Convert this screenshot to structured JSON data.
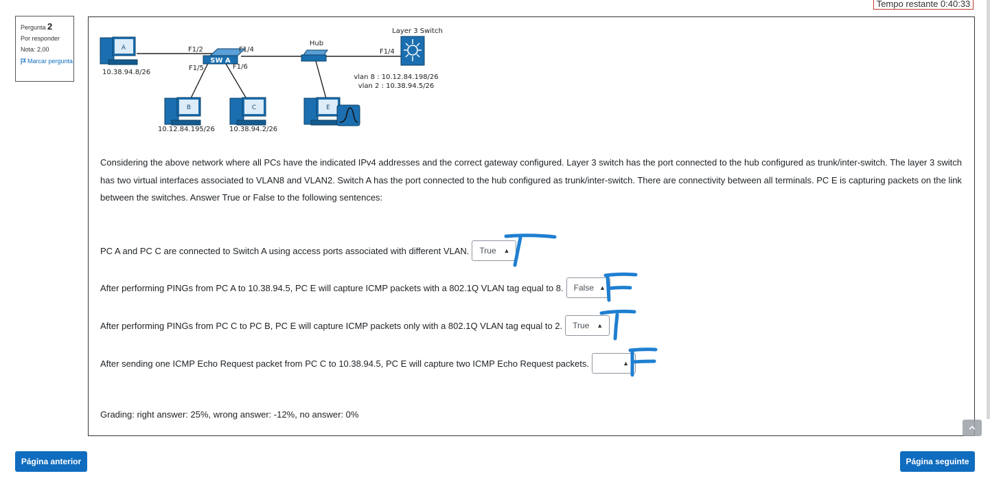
{
  "timer": {
    "label": "Tempo restante 0:40:33"
  },
  "question_info": {
    "label": "Pergunta",
    "number": "2",
    "status": "Por responder",
    "grade": "Nota: 2,00",
    "flag_label": "Marcar pergunta"
  },
  "diagram": {
    "pc_a": {
      "label": "A",
      "ip": "10.38.94.8/26"
    },
    "pc_b": {
      "label": "B",
      "ip": "10.12.84.195/26"
    },
    "pc_c": {
      "label": "C",
      "ip": "10.38.94.2/26"
    },
    "pc_e": {
      "label": "E"
    },
    "switch_a": {
      "label": "SW A",
      "port_1": "F1/2",
      "port_2": "F1/4",
      "port_3": "F1/5",
      "port_4": "F1/6"
    },
    "hub": {
      "label": "Hub"
    },
    "l3_switch": {
      "label": "Layer 3 Switch",
      "port": "F1/4",
      "vlan8": "vlan 8 : 10.12.84.198/26",
      "vlan2": "vlan 2 : 10.38.94.5/26"
    }
  },
  "question_text": "Considering the above network where all PCs have the indicated IPv4 addresses and the correct gateway configured. Layer 3 switch has the port connected to the hub configured as trunk/inter-switch. The layer 3 switch has two virtual interfaces associated to VLAN8 and VLAN2. Switch A has the port connected to the hub configured as trunk/inter-switch. There are connectivity between all terminals. PC E is capturing packets on the link between the switches. Answer True or False to the following sentences:",
  "statements": [
    {
      "text": "PC A and PC C are connected to Switch A using access ports associated with different VLAN.",
      "selected": "True"
    },
    {
      "text": "After performing PINGs from PC A to 10.38.94.5, PC E will capture ICMP packets with a 802.1Q VLAN tag equal to 8.",
      "selected": "False"
    },
    {
      "text": "After performing PINGs from PC C to PC B, PC E will capture ICMP packets only with a 802.1Q VLAN tag equal to 2.",
      "selected": "True"
    },
    {
      "text": "After sending one ICMP Echo Request packet from PC C to 10.38.94.5, PC E will capture two ICMP Echo Request packets.",
      "selected": ""
    }
  ],
  "grading": "Grading: right answer: 25%, wrong answer: -12%, no answer: 0%",
  "nav": {
    "prev": "Página anterior",
    "next": "Página seguinte"
  },
  "colors": {
    "brand": "#0f6cbf",
    "ink": "#1f7fd1",
    "timer_border": "#c0392b"
  },
  "icons": {
    "flag": "flag-icon",
    "scroll_top": "chevron-up-icon",
    "select_caret": "sort-caret-icon"
  }
}
